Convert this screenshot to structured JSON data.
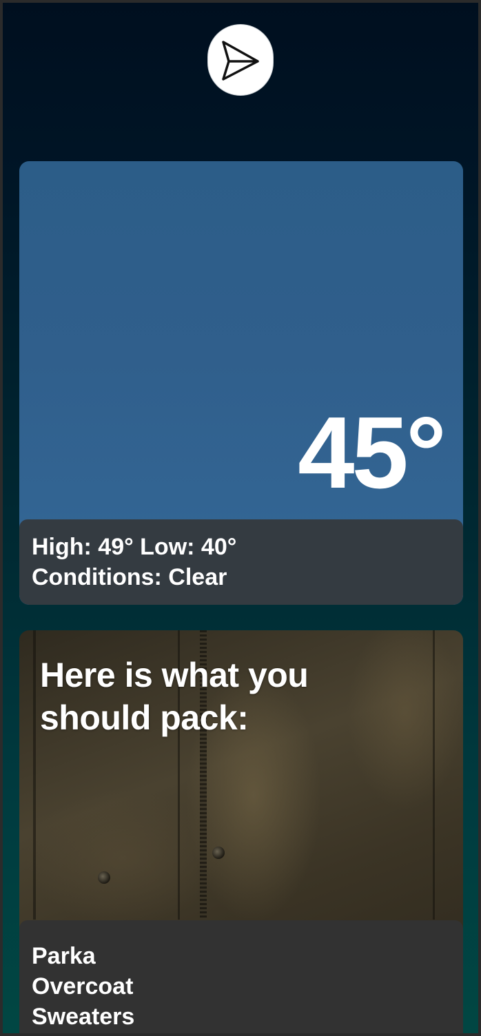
{
  "header": {
    "send_icon": "paper-plane-icon"
  },
  "weather": {
    "temperature": "45°",
    "high_low": "High: 49° Low: 40°",
    "conditions": "Conditions: Clear",
    "card_color": "#305f8c"
  },
  "packing": {
    "heading": "Here is what you should pack:",
    "items": [
      "Parka",
      "Overcoat",
      "Sweaters"
    ]
  }
}
